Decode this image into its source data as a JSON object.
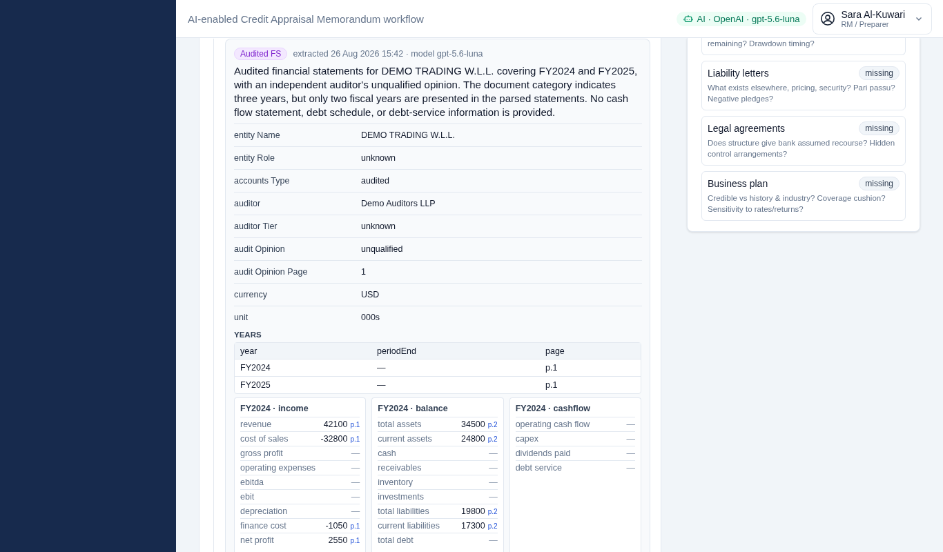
{
  "header": {
    "title": "AI-enabled Credit Appraisal Memorandum workflow",
    "ai_badge": "AI · OpenAI · gpt-5.6-luna",
    "user": {
      "name": "Sara Al-Kuwari",
      "role": "RM / Preparer"
    }
  },
  "document": {
    "tag": "Audited FS",
    "meta": "extracted 26 Aug 2026 15:42 · model gpt-5.6-luna",
    "summary": "Audited financial statements for DEMO TRADING W.L.L. covering FY2024 and FY2025, with an independent auditor's unqualified opinion. The document category indicates three years, but only two fiscal years are presented in the parsed statements. No cash flow statement, debt schedule, or debt-service information is provided.",
    "fields": [
      {
        "label": "entity Name",
        "value": "DEMO TRADING W.L.L."
      },
      {
        "label": "entity Role",
        "value": "unknown"
      },
      {
        "label": "accounts Type",
        "value": "audited"
      },
      {
        "label": "auditor",
        "value": "Demo Auditors LLP"
      },
      {
        "label": "auditor Tier",
        "value": "unknown"
      },
      {
        "label": "audit Opinion",
        "value": "unqualified"
      },
      {
        "label": "audit Opinion Page",
        "value": "1"
      },
      {
        "label": "currency",
        "value": "USD"
      },
      {
        "label": "unit",
        "value": "000s"
      }
    ],
    "years_heading": "YEARS",
    "years_table": {
      "columns": [
        "year",
        "periodEnd",
        "page"
      ],
      "rows": [
        [
          "FY2024",
          "—",
          "p.1"
        ],
        [
          "FY2025",
          "—",
          "p.1"
        ]
      ]
    },
    "statements": [
      {
        "title": "FY2024 · income",
        "rows": [
          {
            "label": "revenue",
            "value": "42100",
            "page": "p.1"
          },
          {
            "label": "cost of sales",
            "value": "-32800",
            "page": "p.1"
          },
          {
            "label": "gross profit",
            "value": "—"
          },
          {
            "label": "operating expenses",
            "value": "—"
          },
          {
            "label": "ebitda",
            "value": "—"
          },
          {
            "label": "ebit",
            "value": "—"
          },
          {
            "label": "depreciation",
            "value": "—"
          },
          {
            "label": "finance cost",
            "value": "-1050",
            "page": "p.1"
          },
          {
            "label": "net profit",
            "value": "2550",
            "page": "p.1"
          }
        ]
      },
      {
        "title": "FY2024 · balance",
        "rows": [
          {
            "label": "total assets",
            "value": "34500",
            "page": "p.2"
          },
          {
            "label": "current assets",
            "value": "24800",
            "page": "p.2"
          },
          {
            "label": "cash",
            "value": "—"
          },
          {
            "label": "receivables",
            "value": "—"
          },
          {
            "label": "inventory",
            "value": "—"
          },
          {
            "label": "investments",
            "value": "—"
          },
          {
            "label": "total liabilities",
            "value": "19800",
            "page": "p.2"
          },
          {
            "label": "current liabilities",
            "value": "17300",
            "page": "p.2"
          },
          {
            "label": "total debt",
            "value": "—"
          }
        ]
      },
      {
        "title": "FY2024 · cashflow",
        "rows": [
          {
            "label": "operating cash flow",
            "value": "—"
          },
          {
            "label": "capex",
            "value": "—"
          },
          {
            "label": "dividends paid",
            "value": "—"
          },
          {
            "label": "debt service",
            "value": "—"
          }
        ]
      }
    ]
  },
  "checklist": [
    {
      "description": "remaining? Drawdown timing?"
    },
    {
      "title": "Liability letters",
      "status": "missing",
      "description": "What exists elsewhere, pricing, security? Pari passu? Negative pledges?"
    },
    {
      "title": "Legal agreements",
      "status": "missing",
      "description": "Does structure give bank assumed recourse? Hidden control arrangements?"
    },
    {
      "title": "Business plan",
      "status": "missing",
      "description": "Credible vs history & industry? Coverage cushion? Sensitivity to rates/returns?"
    }
  ]
}
